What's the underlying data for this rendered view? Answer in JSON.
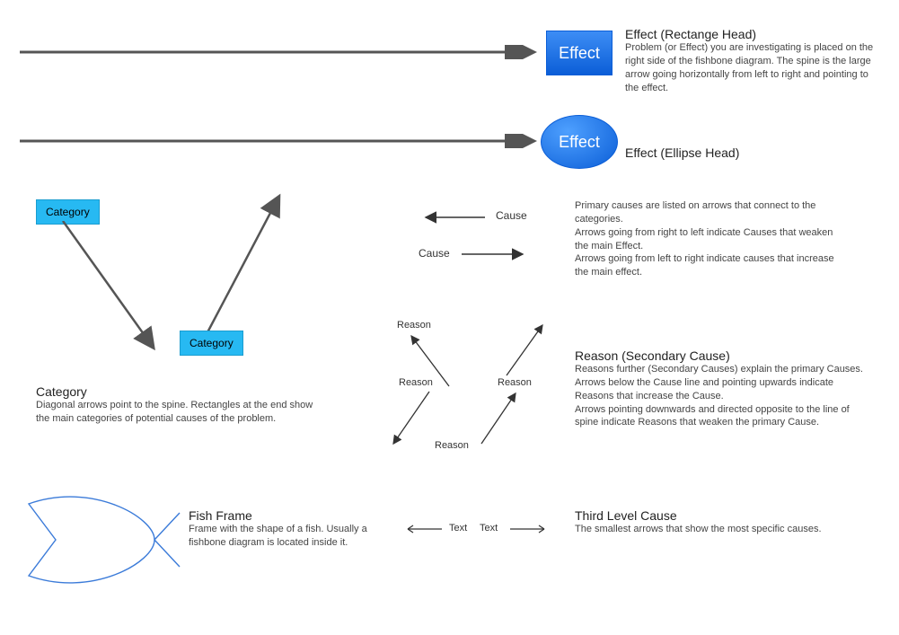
{
  "effect_rect": {
    "box_label": "Effect",
    "title": "Effect (Rectange Head)",
    "desc": "Problem (or Effect) you are investigating is placed on the right side of the fishbone diagram. The spine is the large arrow going horizontally from left to right and pointing to the effect."
  },
  "effect_ellipse": {
    "box_label": "Effect",
    "title": "Effect (Ellipse Head)"
  },
  "category": {
    "box1": "Category",
    "box2": "Category",
    "title": "Category",
    "desc": "Diagonal arrows point to the spine. Rectangles at the end show the main categories of potential causes of the problem."
  },
  "cause": {
    "label1": "Cause",
    "label2": "Cause",
    "desc": "Primary causes are listed on arrows that connect to the categories.\nArrows going from right to left indicate Causes that weaken the main Effect.\nArrows going from left to right indicate causes that increase the main effect."
  },
  "reason": {
    "r1": "Reason",
    "r2": "Reason",
    "r3": "Reason",
    "r4": "Reason",
    "title": "Reason (Secondary Cause)",
    "desc": "Reasons further (Secondary Causes) explain the primary Causes.\nArrows below the Cause line and pointing upwards indicate Reasons that increase the Cause.\nArrows pointing downwards and directed opposite to the line of spine indicate Reasons that weaken the primary Cause."
  },
  "fish": {
    "title": "Fish Frame",
    "desc": "Frame with the shape of a fish. Usually a fishbone diagram is located inside it."
  },
  "third": {
    "t1": "Text",
    "t2": "Text",
    "title": "Third Level Cause",
    "desc": "The smallest arrows that show the most specific causes."
  }
}
